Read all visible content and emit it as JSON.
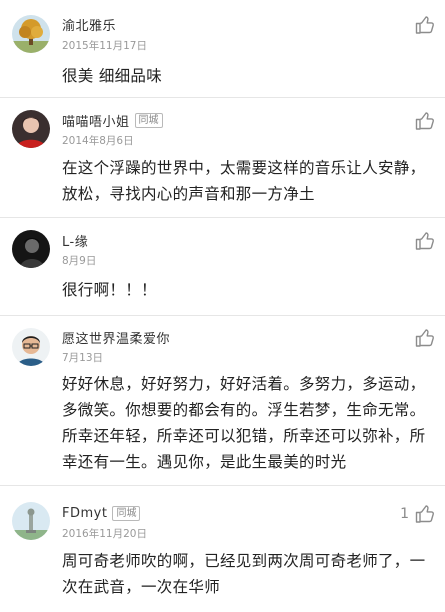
{
  "comments": [
    {
      "username": "渝北雅乐",
      "badge": "",
      "date": "2015年11月17日",
      "text": "很美 细细品味",
      "likes": "",
      "avatar_icon": "avatar-tree"
    },
    {
      "username": "喵喵唔小姐",
      "badge": "同城",
      "date": "2014年8月6日",
      "text": "在这个浮躁的世界中，太需要这样的音乐让人安静，放松，寻找内心的声音和那一方净土",
      "likes": "",
      "avatar_icon": "avatar-woman-red"
    },
    {
      "username": "L-缘",
      "badge": "",
      "date": "8月9日",
      "text": "很行啊！！！",
      "likes": "",
      "avatar_icon": "avatar-dark-portrait"
    },
    {
      "username": "愿这世界温柔爱你",
      "badge": "",
      "date": "7月13日",
      "text": "好好休息，好好努力，好好活着。多努力，多运动，多微笑。你想要的都会有的。浮生若梦，生命无常。所幸还年轻，所幸还可以犯错，所幸还可以弥补，所幸还有一生。遇见你，是此生最美的时光",
      "likes": "",
      "avatar_icon": "avatar-man-glasses"
    },
    {
      "username": "FDmyt",
      "badge": "同城",
      "date": "2016年11月20日",
      "text": "周可奇老师吹的啊，已经见到两次周可奇老师了，一次在武音，一次在华师",
      "likes": "1",
      "avatar_icon": "avatar-statue"
    }
  ],
  "like_icon": "thumbs-up-icon",
  "colors": {
    "text": "#222222",
    "secondary": "#999999",
    "divider": "#e6e6e6"
  }
}
